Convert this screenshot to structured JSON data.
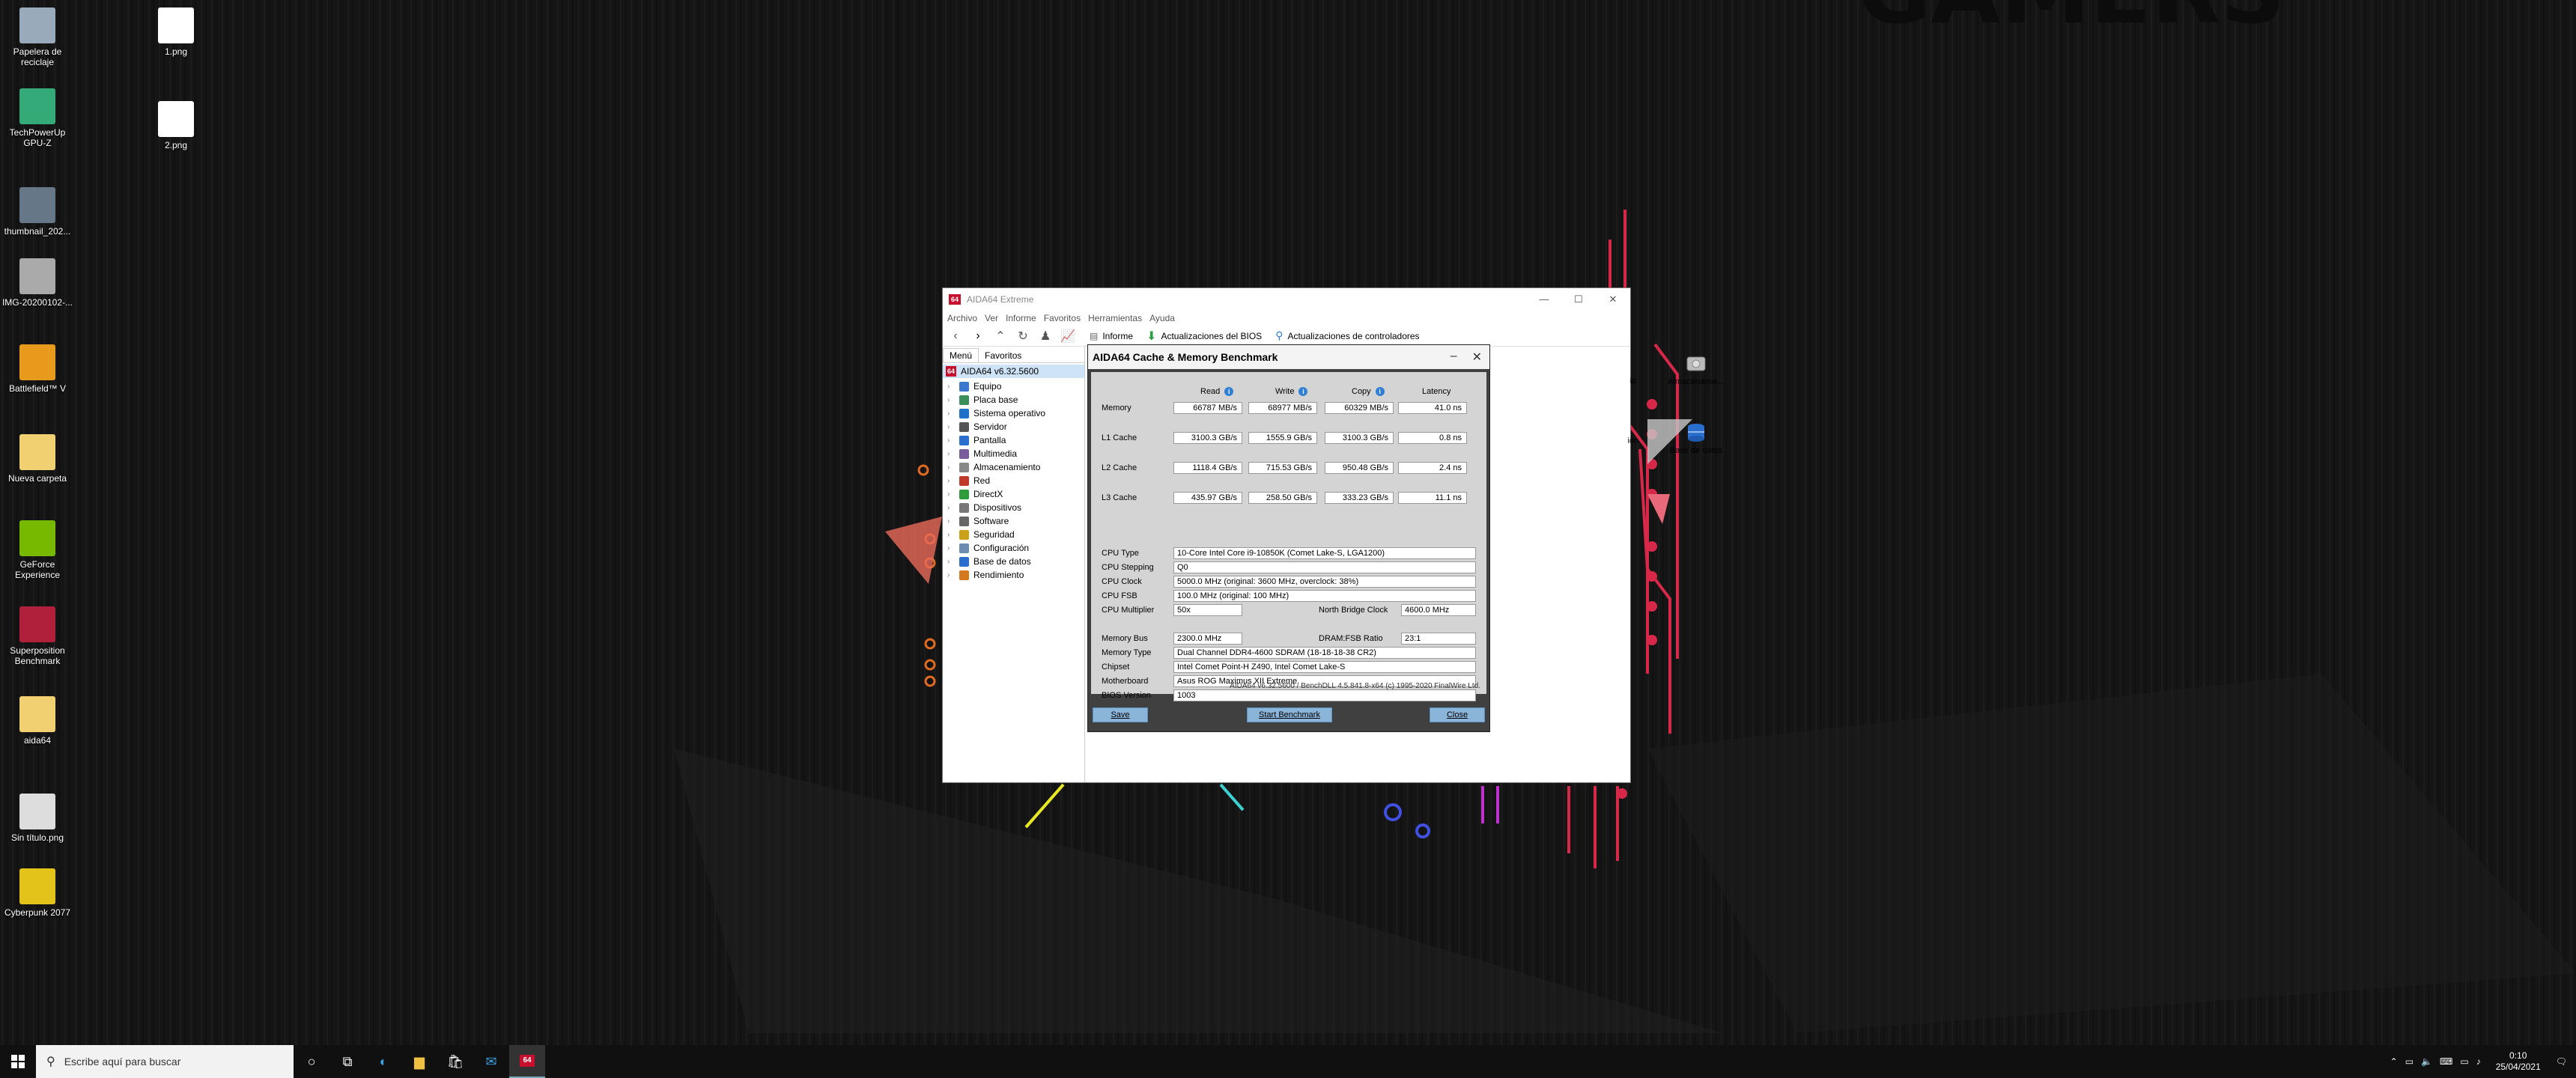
{
  "desktop": {
    "icons": [
      {
        "label": "Papelera de reciclaje",
        "color": "#9ab"
      },
      {
        "label": "1.png",
        "color": "#fff"
      },
      {
        "label": "TechPowerUp GPU-Z",
        "color": "#3a7"
      },
      {
        "label": "2.png",
        "color": "#fff"
      },
      {
        "label": "thumbnail_202...",
        "color": "#678"
      },
      {
        "label": "IMG-20200102-...",
        "color": "#aaa"
      },
      {
        "label": "Battlefield™ V",
        "color": "#e89a1c"
      },
      {
        "label": "Nueva carpeta",
        "color": "#f0d070"
      },
      {
        "label": "GeForce Experience",
        "color": "#76b900"
      },
      {
        "label": "Superposition Benchmark",
        "color": "#b0203a"
      },
      {
        "label": "aida64",
        "color": "#f0d070"
      },
      {
        "label": "Sin título.png",
        "color": "#ddd"
      },
      {
        "label": "Cyberpunk 2077",
        "color": "#e3c21a"
      }
    ]
  },
  "taskbar": {
    "search_placeholder": "Escribe aquí para buscar",
    "time": "0:10",
    "date": "25/04/2021"
  },
  "aida": {
    "title": "AIDA64 Extreme",
    "menu": [
      "Archivo",
      "Ver",
      "Informe",
      "Favoritos",
      "Herramientas",
      "Ayuda"
    ],
    "toolbar": {
      "report": "Informe",
      "bios_updates": "Actualizaciones del BIOS",
      "driver_updates": "Actualizaciones de controladores"
    },
    "side_tabs": [
      "Menú",
      "Favoritos"
    ],
    "tree_root": "AIDA64 v6.32.5600",
    "tree": [
      {
        "label": "Equipo",
        "color": "#3a78d0"
      },
      {
        "label": "Placa base",
        "color": "#3a8f5a"
      },
      {
        "label": "Sistema operativo",
        "color": "#1e70c8"
      },
      {
        "label": "Servidor",
        "color": "#555"
      },
      {
        "label": "Pantalla",
        "color": "#2a6fd0"
      },
      {
        "label": "Multimedia",
        "color": "#7a5c9c"
      },
      {
        "label": "Almacenamiento",
        "color": "#888"
      },
      {
        "label": "Red",
        "color": "#c0392b"
      },
      {
        "label": "DirectX",
        "color": "#2e9c3a"
      },
      {
        "label": "Dispositivos",
        "color": "#777"
      },
      {
        "label": "Software",
        "color": "#666"
      },
      {
        "label": "Seguridad",
        "color": "#c9a21a"
      },
      {
        "label": "Configuración",
        "color": "#6b8cae"
      },
      {
        "label": "Base de datos",
        "color": "#2a6fd0"
      },
      {
        "label": "Rendimiento",
        "color": "#d4791e"
      }
    ],
    "content_icons": {
      "storage": "Almacenamie...",
      "database": "Base de datos",
      "partial": "ión",
      "partial2": "ia"
    }
  },
  "benchmark": {
    "title": "AIDA64 Cache & Memory Benchmark",
    "columns": [
      "Read",
      "Write",
      "Copy",
      "Latency"
    ],
    "rows": [
      {
        "label": "Memory",
        "read": "66787 MB/s",
        "write": "68977 MB/s",
        "copy": "60329 MB/s",
        "latency": "41.0 ns"
      },
      {
        "label": "L1 Cache",
        "read": "3100.3 GB/s",
        "write": "1555.9 GB/s",
        "copy": "3100.3 GB/s",
        "latency": "0.8 ns"
      },
      {
        "label": "L2 Cache",
        "read": "1118.4 GB/s",
        "write": "715.53 GB/s",
        "copy": "950.48 GB/s",
        "latency": "2.4 ns"
      },
      {
        "label": "L3 Cache",
        "read": "435.97 GB/s",
        "write": "258.50 GB/s",
        "copy": "333.23 GB/s",
        "latency": "11.1 ns"
      }
    ],
    "cpu": {
      "type_label": "CPU Type",
      "type": "10-Core Intel Core i9-10850K  (Comet Lake-S, LGA1200)",
      "stepping_label": "CPU Stepping",
      "stepping": "Q0",
      "clock_label": "CPU Clock",
      "clock": "5000.0 MHz  (original: 3600 MHz, overclock: 38%)",
      "fsb_label": "CPU FSB",
      "fsb": "100.0 MHz  (original: 100 MHz)",
      "multiplier_label": "CPU Multiplier",
      "multiplier": "50x",
      "nb_clock_label": "North Bridge Clock",
      "nb_clock": "4600.0 MHz"
    },
    "memory": {
      "bus_label": "Memory Bus",
      "bus": "2300.0 MHz",
      "ratio_label": "DRAM:FSB Ratio",
      "ratio": "23:1",
      "type_label": "Memory Type",
      "type": "Dual Channel DDR4-4600 SDRAM  (18-18-18-38 CR2)",
      "chipset_label": "Chipset",
      "chipset": "Intel Comet Point-H Z490, Intel Comet Lake-S",
      "motherboard_label": "Motherboard",
      "motherboard": "Asus ROG Maximus XII Extreme",
      "bios_label": "BIOS Version",
      "bios": "1003"
    },
    "footer": "AIDA64 v6.32.5600 / BenchDLL 4.5.841.8-x64  (c) 1995-2020 FinalWire Ltd.",
    "buttons": {
      "save": "Save",
      "start": "Start Benchmark",
      "close": "Close"
    }
  }
}
